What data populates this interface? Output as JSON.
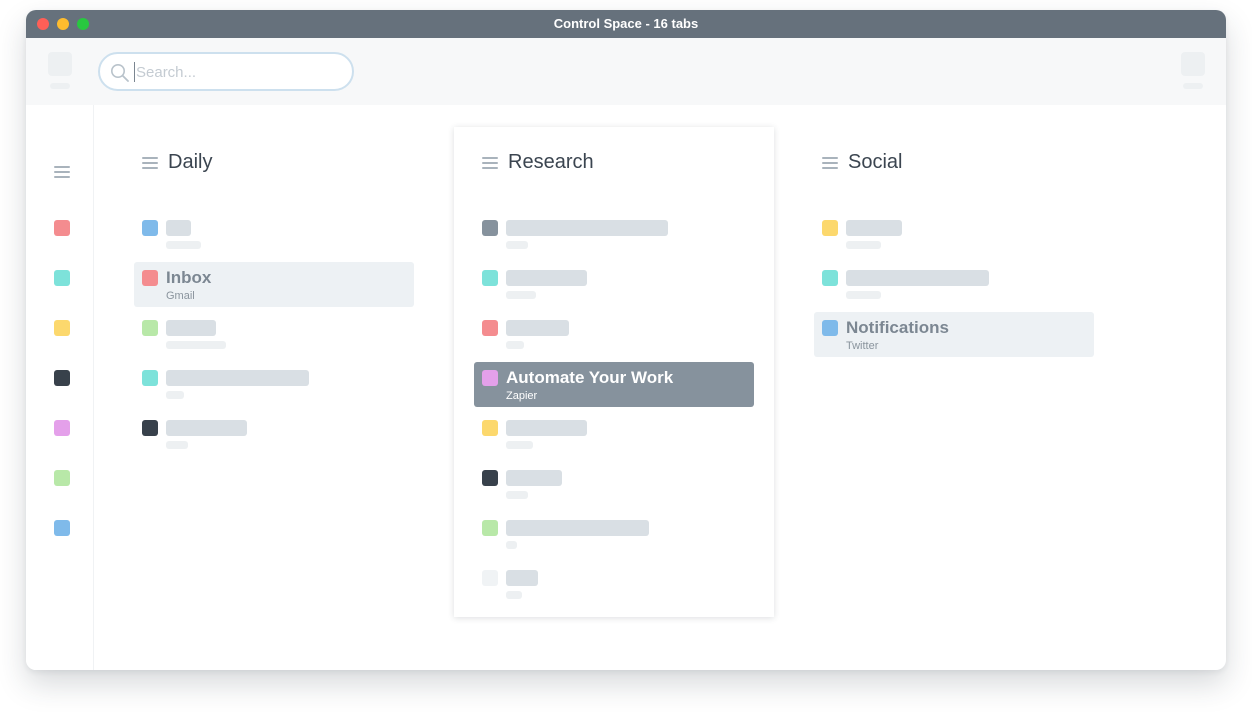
{
  "window": {
    "title": "Control Space - 16 tabs",
    "traffic_colors": [
      "#fe5f57",
      "#febc2e",
      "#28c840"
    ]
  },
  "search": {
    "placeholder": "Search..."
  },
  "sidebar": {
    "colors": [
      "#f48c8f",
      "#7de2da",
      "#fcd86d",
      "#38414b",
      "#e4a0ea",
      "#b8e8a8",
      "#7fbaea"
    ]
  },
  "columns": [
    {
      "name": "Daily",
      "tabs": [
        {
          "color": "#7fbaea"
        },
        {
          "color": "#f48c8f",
          "title": "Inbox",
          "subtitle": "Gmail",
          "state": "highlight"
        },
        {
          "color": "#b8e8a8"
        },
        {
          "color": "#7de2da"
        },
        {
          "color": "#38414b"
        }
      ]
    },
    {
      "name": "Research",
      "tabs": [
        {
          "color": "#86929d"
        },
        {
          "color": "#7de2da"
        },
        {
          "color": "#f48c8f"
        },
        {
          "color": "#e4a0ea",
          "title": "Automate Your Work",
          "subtitle": "Zapier",
          "state": "selected"
        },
        {
          "color": "#fcd86d"
        },
        {
          "color": "#38414b"
        },
        {
          "color": "#b8e8a8"
        },
        {
          "color": "#f0f3f5"
        }
      ]
    },
    {
      "name": "Social",
      "tabs": [
        {
          "color": "#fcd86d"
        },
        {
          "color": "#7de2da"
        },
        {
          "color": "#7fbaea",
          "title": "Notifications",
          "subtitle": "Twitter",
          "state": "highlight"
        }
      ]
    }
  ]
}
